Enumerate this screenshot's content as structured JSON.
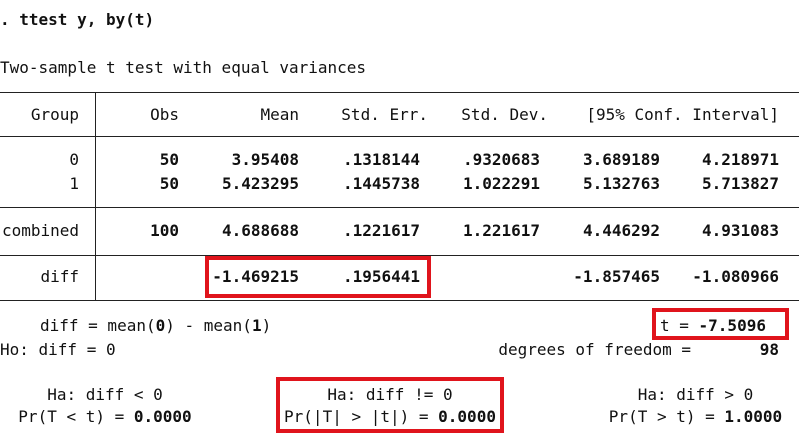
{
  "command": ". ttest y, by(t)",
  "subtitle": "Two-sample t test with equal variances",
  "table": {
    "headers": {
      "group": "Group",
      "obs": "Obs",
      "mean": "Mean",
      "std_err": "Std. Err.",
      "std_dev": "Std. Dev.",
      "ci": "[95% Conf. Interval]"
    },
    "rows": [
      {
        "group": "0",
        "obs": "50",
        "mean": "3.95408",
        "std_err": ".1318144",
        "std_dev": ".9320683",
        "ci_low": "3.689189",
        "ci_high": "4.218971"
      },
      {
        "group": "1",
        "obs": "50",
        "mean": "5.423295",
        "std_err": ".1445738",
        "std_dev": "1.022291",
        "ci_low": "5.132763",
        "ci_high": "5.713827"
      },
      {
        "group": "combined",
        "obs": "100",
        "mean": "4.688688",
        "std_err": ".1221617",
        "std_dev": "1.221617",
        "ci_low": "4.446292",
        "ci_high": "4.931083"
      },
      {
        "group": "diff",
        "obs": "",
        "mean": "-1.469215",
        "std_err": ".1956441",
        "std_dev": "",
        "ci_low": "-1.857465",
        "ci_high": "-1.080966"
      }
    ]
  },
  "stats": {
    "diff_def_prefix": "diff = mean(",
    "diff_def_a": "0",
    "diff_def_mid": ") - mean(",
    "diff_def_b": "1",
    "diff_def_suffix": ")",
    "t_label": "t = ",
    "t_value": "-7.5096",
    "ho": "Ho: diff = 0",
    "df_label": "degrees of freedom =",
    "df_value": "98"
  },
  "hypotheses": {
    "left": {
      "ha": "Ha: diff < 0",
      "p_label": "Pr(T < t) = ",
      "p_value": "0.0000"
    },
    "mid": {
      "ha": "Ha: diff != 0",
      "p_label": "Pr(|T| > |t|) = ",
      "p_value": "0.0000"
    },
    "right": {
      "ha": "Ha: diff > 0",
      "p_label": "Pr(T > t) = ",
      "p_value": "1.0000"
    }
  },
  "colors": {
    "highlight_box": "#e0141c"
  }
}
